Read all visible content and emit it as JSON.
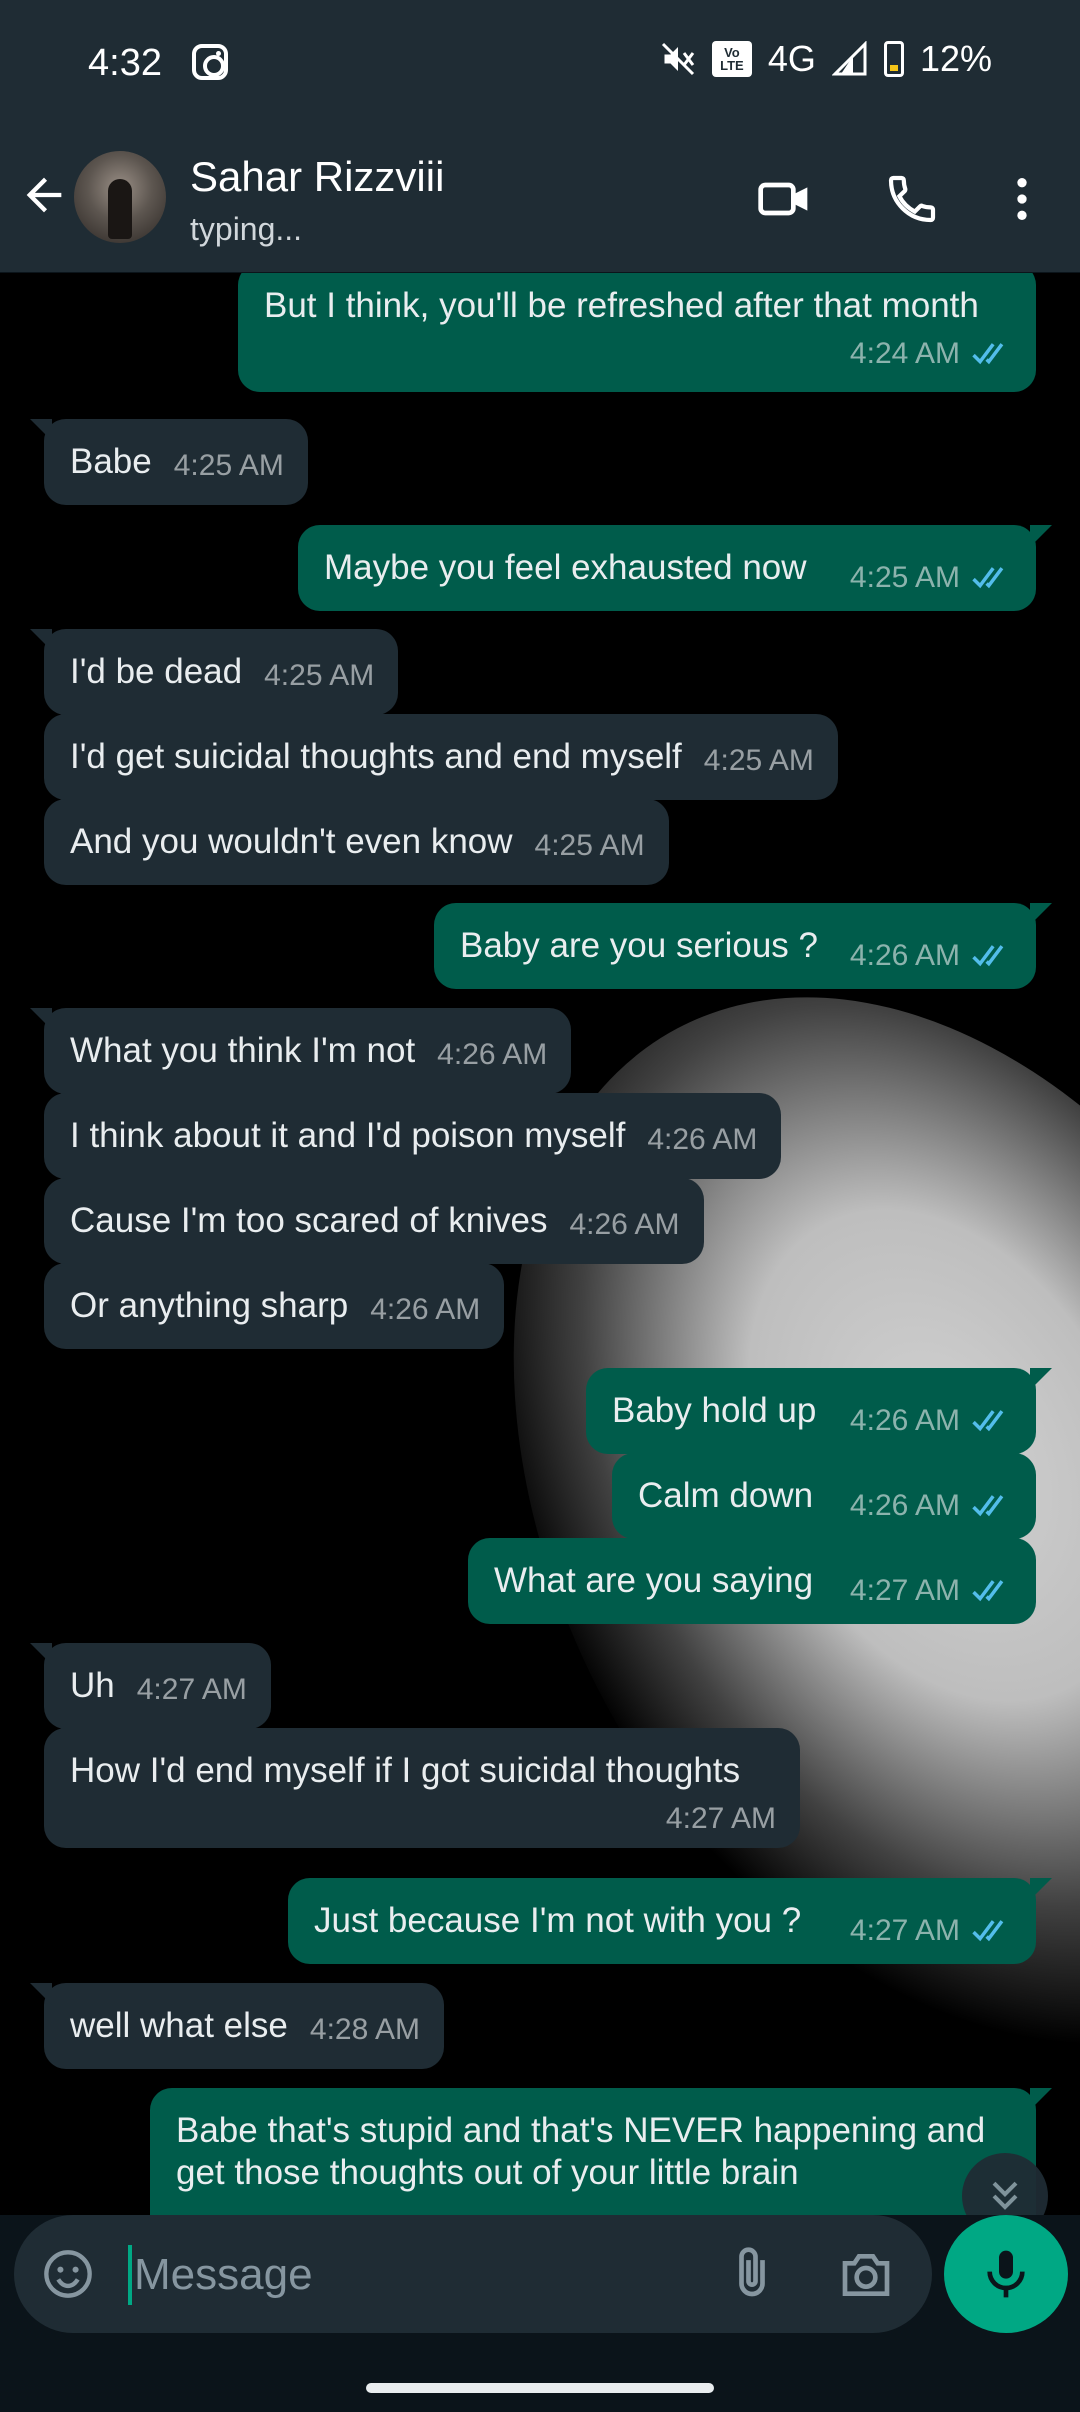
{
  "status_bar": {
    "time": "4:32",
    "volte_top": "Vo",
    "volte_bottom": "LTE",
    "network": "4G",
    "battery": "12%"
  },
  "header": {
    "contact_name": "Sahar Rizzviii",
    "contact_status": "typing..."
  },
  "messages": [
    {
      "dir": "out",
      "text": "But I think, you'll be refreshed after that month",
      "time": "4:24 AM",
      "read": true
    },
    {
      "dir": "in",
      "text": "Babe",
      "time": "4:25 AM"
    },
    {
      "dir": "out",
      "text": "Maybe you feel exhausted now",
      "time": "4:25 AM",
      "read": true
    },
    {
      "dir": "in",
      "text": "I'd be dead",
      "time": "4:25 AM"
    },
    {
      "dir": "in",
      "text": "I'd get suicidal thoughts and end myself",
      "time": "4:25 AM"
    },
    {
      "dir": "in",
      "text": "And you wouldn't even know",
      "time": "4:25 AM"
    },
    {
      "dir": "out",
      "text": "Baby are you serious ?",
      "time": "4:26 AM",
      "read": true
    },
    {
      "dir": "in",
      "text": "What you think I'm not",
      "time": "4:26 AM"
    },
    {
      "dir": "in",
      "text": "I think about it and I'd poison myself",
      "time": "4:26 AM"
    },
    {
      "dir": "in",
      "text": "Cause I'm too scared of knives",
      "time": "4:26 AM"
    },
    {
      "dir": "in",
      "text": "Or anything sharp",
      "time": "4:26 AM"
    },
    {
      "dir": "out",
      "text": "Baby hold up",
      "time": "4:26 AM",
      "read": true
    },
    {
      "dir": "out",
      "text": "Calm down",
      "time": "4:26 AM",
      "read": true
    },
    {
      "dir": "out",
      "text": "What are you saying",
      "time": "4:27 AM",
      "read": true
    },
    {
      "dir": "in",
      "text": "Uh",
      "time": "4:27 AM"
    },
    {
      "dir": "in",
      "text": "How I'd end myself if I got suicidal thoughts",
      "time": "4:27 AM"
    },
    {
      "dir": "out",
      "text": "Just because I'm not with you ?",
      "time": "4:27 AM",
      "read": true
    },
    {
      "dir": "in",
      "text": "well what else",
      "time": "4:28 AM"
    },
    {
      "dir": "out",
      "text": "Babe that's stupid and that's NEVER happening and get those thoughts out of your little brain",
      "time": "",
      "read": false
    }
  ],
  "composer": {
    "placeholder": "Message"
  },
  "colors": {
    "header_bg": "#1f2c34",
    "incoming_bubble": "#1f2c34",
    "outgoing_bubble": "#005c4b",
    "accent": "#00a884",
    "read_ticks": "#53bdeb"
  },
  "icons": [
    "instagram-icon",
    "mute-icon",
    "signal-icon",
    "battery-icon",
    "back-arrow-icon",
    "video-call-icon",
    "phone-icon",
    "more-options-icon",
    "double-check-icon",
    "scroll-down-icon",
    "emoji-icon",
    "attach-icon",
    "camera-icon",
    "mic-icon"
  ]
}
